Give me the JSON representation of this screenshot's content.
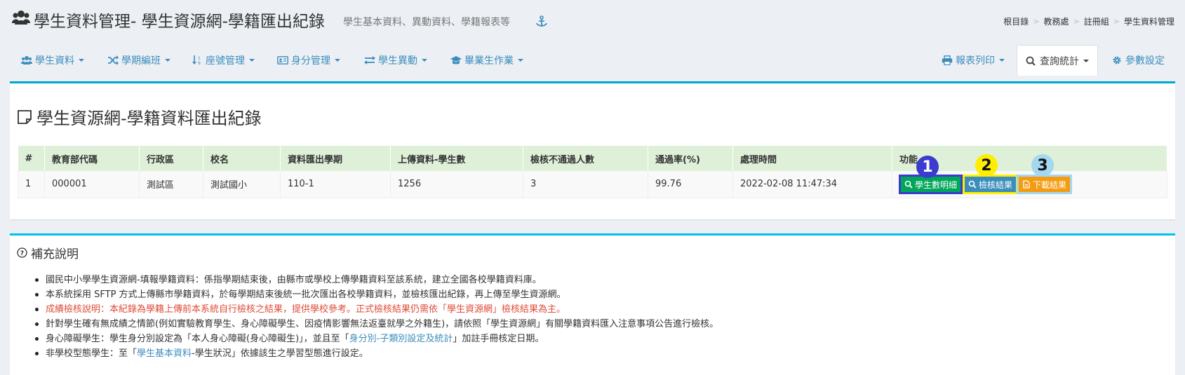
{
  "header": {
    "title": "學生資料管理- 學生資源網-學籍匯出紀錄",
    "subtitle": "學生基本資料、異動資料、學籍報表等",
    "breadcrumb": [
      "根目錄",
      "教務處",
      "註冊組",
      "學生資料管理"
    ]
  },
  "nav": {
    "left": [
      {
        "label": "學生資料",
        "icon": "users-icon"
      },
      {
        "label": "學期編班",
        "icon": "shuffle-icon"
      },
      {
        "label": "座號管理",
        "icon": "sort-icon"
      },
      {
        "label": "身分管理",
        "icon": "id-card-icon"
      },
      {
        "label": "學生異動",
        "icon": "exchange-icon"
      },
      {
        "label": "畢業生作業",
        "icon": "graduation-cap-icon"
      }
    ],
    "right": [
      {
        "label": "報表列印",
        "icon": "print-icon"
      },
      {
        "label": "查詢統計",
        "icon": "search-icon",
        "active": true
      },
      {
        "label": "參數設定",
        "icon": "gear-icon"
      }
    ]
  },
  "records": {
    "title": "學生資源網-學籍資料匯出紀錄",
    "columns": [
      "#",
      "教育部代碼",
      "行政區",
      "校名",
      "資料匯出學期",
      "上傳資料-學生數",
      "檢核不通過人數",
      "通過率(%)",
      "處理時間",
      "功能"
    ],
    "rows": [
      [
        "1",
        "000001",
        "測試區",
        "測試國小",
        "110-1",
        "1256",
        "3",
        "99.76",
        "2022-02-08 11:47:34"
      ]
    ],
    "actions": {
      "detail": "學生數明細",
      "check": "檢核結果",
      "download": "下載結果"
    },
    "badges": [
      "1",
      "2",
      "3"
    ]
  },
  "notes": {
    "title": "補充說明",
    "items": [
      {
        "text": "國民中小學學生資源網-填報學籍資料：係指學期結束後，由縣市或學校上傳學籍資料至該系統，建立全國各校學籍資料庫。"
      },
      {
        "text": "本系統採用 SFTP 方式上傳縣市學籍資料，於每學期結束後統一批次匯出各校學籍資料，並檢核匯出紀錄，再上傳至學生資源網。"
      },
      {
        "text": "成績檢核說明：本紀錄為學籍上傳前本系統自行檢核之結果，提供學校參考。正式檢核結果仍需依「學生資源網」檢核結果為主。"
      },
      {
        "text": "針對學生確有無成績之情節(例如實驗教育學生、身心障礙學生、因疫情影響無法返臺就學之外籍生)，請依照「學生資源網」有關學籍資料匯入注意事項公告進行檢核。"
      },
      {
        "pre": "身心障礙學生：學生身分別設定為「本人身心障礙(身心障礙生)」，並且至「",
        "link": "身分別-子類別設定及統計",
        "post": "」加註手冊核定日期。"
      },
      {
        "pre": "非學校型態學生：至「",
        "link": "學生基本資料",
        "post": "-學生狀況」依據該生之學習型態進行設定。"
      }
    ]
  },
  "colors": {
    "accent": "#3c8dbc",
    "header_row": "#dff0d8",
    "btn_green": "#00a65a",
    "btn_blue": "#3c8dbc",
    "btn_orange": "#f39c12",
    "badge1": "#3b3bcf",
    "badge2": "#ffee00",
    "badge3": "#a3d8f0",
    "warning_text": "#dd4b39"
  }
}
